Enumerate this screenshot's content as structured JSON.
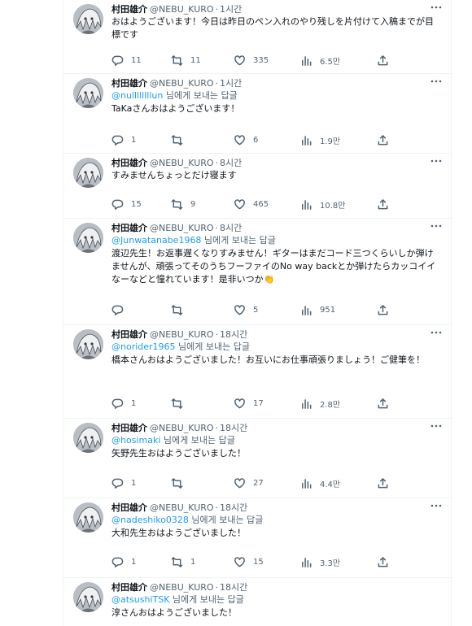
{
  "tweets": [
    {
      "name": "村田雄介",
      "handle": "@NEBU_KURO",
      "time": "1시간",
      "reply_to": "",
      "reply_suffix": "",
      "text": "おはようございます！今日は昨日のペン入れのやり残しを片付けて入稿までが目標です",
      "replies": "11",
      "retweets": "11",
      "likes": "335",
      "views": "6.5만"
    },
    {
      "name": "村田雄介",
      "handle": "@NEBU_KURO",
      "time": "1시간",
      "reply_to": "@nullllllllun",
      "reply_suffix": " 님에게 보내는 답글",
      "text": "TaKaさんおはようございます！",
      "replies": "1",
      "retweets": "",
      "likes": "6",
      "views": "1.9만"
    },
    {
      "name": "村田雄介",
      "handle": "@NEBU_KURO",
      "time": "8시간",
      "reply_to": "",
      "reply_suffix": "",
      "text": "すみませんちょっとだけ寝ます",
      "replies": "15",
      "retweets": "9",
      "likes": "465",
      "views": "10.8만"
    },
    {
      "name": "村田雄介",
      "handle": "@NEBU_KURO",
      "time": "8시간",
      "reply_to": "@Junwatanabe1968",
      "reply_suffix": " 님에게 보내는 답글",
      "text": "渡辺先生！お返事遅くなりすみません！ギターはまだコード三つくらいしか弾けませんが、頑張ってそのうちフーファイのNo way backとか弾けたらカッコイイなーなどと憧れています！是非いつか👏",
      "replies": "",
      "retweets": "",
      "likes": "5",
      "views": "951"
    },
    {
      "name": "村田雄介",
      "handle": "@NEBU_KURO",
      "time": "18시간",
      "reply_to": "@norider1965",
      "reply_suffix": " 님에게 보내는 답글",
      "text": "橋本さんおはようございました！お互いにお仕事頑張りましょう！ご健筆を！",
      "replies": "1",
      "retweets": "",
      "likes": "17",
      "views": "2.8만"
    },
    {
      "name": "村田雄介",
      "handle": "@NEBU_KURO",
      "time": "18시간",
      "reply_to": "@hosimaki",
      "reply_suffix": " 님에게 보내는 답글",
      "text": "矢野先生おはようございました！",
      "replies": "1",
      "retweets": "",
      "likes": "27",
      "views": "4.4만"
    },
    {
      "name": "村田雄介",
      "handle": "@NEBU_KURO",
      "time": "18시간",
      "reply_to": "@nadeshiko0328",
      "reply_suffix": " 님에게 보내는 답글",
      "text": "大和先生おはようございました！",
      "replies": "1",
      "retweets": "1",
      "likes": "15",
      "views": "3.3만"
    },
    {
      "name": "村田雄介",
      "handle": "@NEBU_KURO",
      "time": "18시간",
      "reply_to": "@atsushiTSK",
      "reply_suffix": " 님에게 보내는 답글",
      "text": "淳さんおはようございました！",
      "replies": "",
      "retweets": "",
      "likes": "",
      "views": ""
    }
  ]
}
